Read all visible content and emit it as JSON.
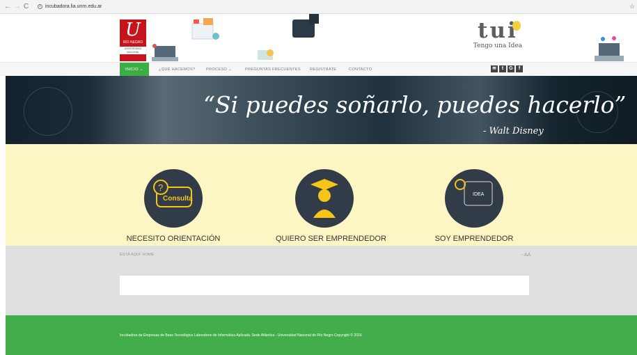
{
  "browser": {
    "url": "incubadora.lia.unrn.edu.ar",
    "back_icon": "back-arrow-icon",
    "forward_icon": "forward-arrow-icon",
    "reload_icon": "reload-icon",
    "info_icon": "info-icon",
    "star_icon": "star-icon"
  },
  "header": {
    "logo": {
      "u": "U",
      "line1": "RÍO NEGRO",
      "line2": "UNIVERSIDAD",
      "line3": "NACIONAL"
    },
    "brand": {
      "name": "tui",
      "tagline": "Tengo una Idea"
    }
  },
  "nav": {
    "items": [
      {
        "label": "INICIO"
      },
      {
        "label": "¿QUÉ HACEMOS?"
      },
      {
        "label": "PROCESO"
      },
      {
        "label": "PREGUNTAS FRECUENTES"
      },
      {
        "label": "REGISTRATE"
      },
      {
        "label": "CONTACTO"
      }
    ],
    "social": [
      "rss",
      "t",
      "G",
      "f"
    ]
  },
  "hero": {
    "quote": "“Si puedes soñarlo, puedes hacerlo”",
    "author": "- Walt Disney"
  },
  "cta": [
    {
      "label": "NECESITO ORIENTACIÓN",
      "icon_text": "Consulta",
      "icon": "speech-bubble-icon"
    },
    {
      "label": "QUIERO SER EMPRENDEDOR",
      "icon": "graduate-icon"
    },
    {
      "label": "SOY EMPRENDEDOR",
      "icon_text": "IDEA",
      "icon": "lightbulb-idea-icon"
    }
  ],
  "breadcrumb": {
    "label": "ESTÁ AQUÍ:",
    "current": "HOME"
  },
  "font_size": {
    "small": "-",
    "label": "AA"
  },
  "footer": {
    "text": "Incubadora de Empresas de Base Tecnológica Laboratorio de Informática Aplicada. Sede Atlántica - Universidad Nacional de Río Negro Copyright © 2016"
  },
  "colors": {
    "green": "#43ad4b",
    "yellow": "#fcf6c4",
    "circle": "#323c48",
    "accent_yellow": "#f5c518",
    "red": "#c4151c"
  }
}
